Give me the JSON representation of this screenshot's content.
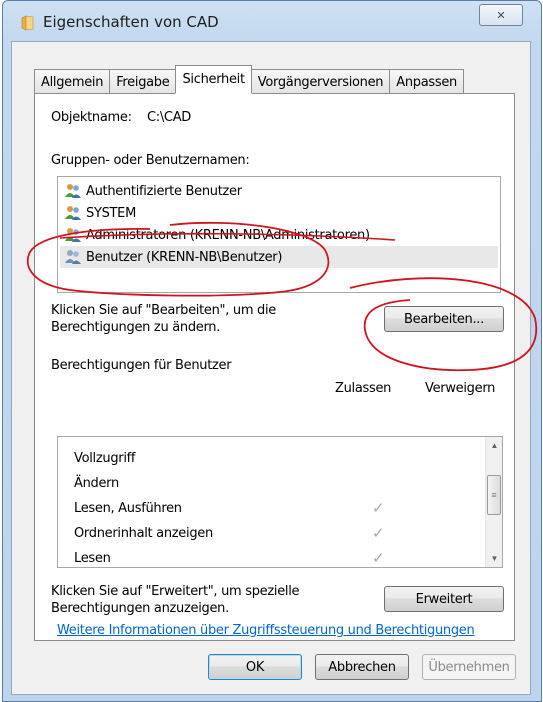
{
  "window": {
    "title": "Eigenschaften von CAD",
    "close_glyph": "✕",
    "folder_icon": "folder-icon"
  },
  "tabs": [
    {
      "label": "Allgemein",
      "active": false
    },
    {
      "label": "Freigabe",
      "active": false
    },
    {
      "label": "Sicherheit",
      "active": true
    },
    {
      "label": "Vorgängerversionen",
      "active": false
    },
    {
      "label": "Anpassen",
      "active": false
    }
  ],
  "security": {
    "object_label": "Objektname:",
    "object_value": "C:\\CAD",
    "groups_label": "Gruppen- oder Benutzernamen:",
    "groups": [
      {
        "name": "Authentifizierte Benutzer",
        "selected": false
      },
      {
        "name": "SYSTEM",
        "selected": false
      },
      {
        "name": "Administratoren (KRENN-NB\\Administratoren)",
        "selected": false
      },
      {
        "name": "Benutzer (KRENN-NB\\Benutzer)",
        "selected": true
      }
    ],
    "edit_hint_line1": "Klicken Sie auf \"Bearbeiten\", um die",
    "edit_hint_line2": "Berechtigungen zu ändern.",
    "edit_button": "Bearbeiten...",
    "permissions_for": "Berechtigungen für Benutzer",
    "col_allow": "Zulassen",
    "col_deny": "Verweigern",
    "permissions": [
      {
        "name": "Vollzugriff",
        "allow": false
      },
      {
        "name": "Ändern",
        "allow": false
      },
      {
        "name": "Lesen, Ausführen",
        "allow": true
      },
      {
        "name": "Ordnerinhalt anzeigen",
        "allow": true
      },
      {
        "name": "Lesen",
        "allow": true
      }
    ],
    "check_glyph": "✓",
    "advanced_hint_line1": "Klicken Sie auf \"Erweitert\", um spezielle",
    "advanced_hint_line2": "Berechtigungen anzuzeigen.",
    "advanced_button": "Erweitert",
    "link": "Weitere Informationen über Zugriffssteuerung und Berechtigungen"
  },
  "footer": {
    "ok": "OK",
    "cancel": "Abbrechen",
    "apply": "Übernehmen"
  },
  "colors": {
    "annotation": "#d0141e",
    "link": "#0066cc"
  }
}
